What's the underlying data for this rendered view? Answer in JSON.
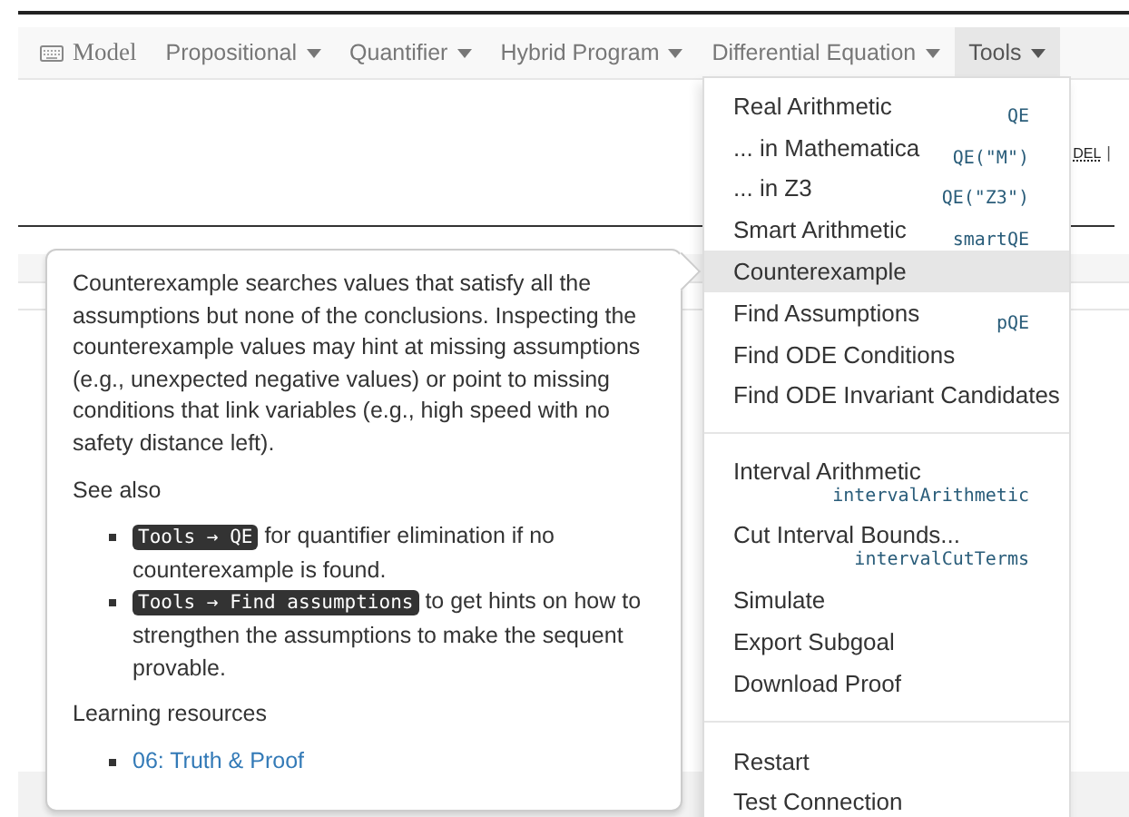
{
  "navbar": {
    "brand": "Model",
    "items": [
      {
        "label": "Propositional",
        "selected": false
      },
      {
        "label": "Quantifier",
        "selected": false
      },
      {
        "label": "Hybrid Program",
        "selected": false
      },
      {
        "label": "Differential Equation",
        "selected": false
      },
      {
        "label": "Tools",
        "selected": true
      }
    ]
  },
  "page": {
    "fragment": "DEL",
    "cursor": "|"
  },
  "menu": {
    "groups": [
      [
        {
          "label": "Real Arithmetic",
          "shortcut": "QE",
          "kind": "inline",
          "selected": false
        },
        {
          "label": "... in Mathematica",
          "shortcut": "QE(\"M\")",
          "kind": "inline",
          "selected": false
        },
        {
          "label": "... in Z3",
          "shortcut": "QE(\"Z3\")",
          "kind": "inline",
          "selected": false
        },
        {
          "label": "Smart Arithmetic",
          "shortcut": "smartQE",
          "kind": "inline",
          "selected": false
        },
        {
          "label": "Counterexample",
          "kind": "inline",
          "selected": true
        },
        {
          "label": "Find Assumptions",
          "shortcut": "pQE",
          "kind": "inline",
          "selected": false
        },
        {
          "label": "Find ODE Conditions",
          "kind": "inline",
          "selected": false
        },
        {
          "label": "Find ODE Invariant Candidates",
          "kind": "inline",
          "selected": false
        }
      ],
      [
        {
          "label": "Interval Arithmetic",
          "shortcut": "intervalArithmetic",
          "kind": "below",
          "selected": false
        },
        {
          "label": "Cut Interval Bounds...",
          "shortcut": "intervalCutTerms",
          "kind": "below",
          "selected": false
        },
        {
          "label": "Simulate",
          "kind": "inline",
          "selected": false
        },
        {
          "label": "Export Subgoal",
          "kind": "inline",
          "selected": false
        },
        {
          "label": "Download Proof",
          "kind": "inline",
          "selected": false
        }
      ],
      [
        {
          "label": "Restart",
          "kind": "inline",
          "selected": false
        },
        {
          "label": "Test Connection",
          "kind": "inline",
          "selected": false
        }
      ]
    ]
  },
  "popover": {
    "paragraph": "Counterexample searches values that satisfy all the assumptions but none of the conclusions. Inspecting the counterexample values may hint at missing assumptions (e.g., unexpected negative values) or point to missing conditions that link variables (e.g., high speed with no safety distance left).",
    "see_also_heading": "See also",
    "see_also": [
      {
        "code": "Tools → QE",
        "text": "for quantifier elimination if no counterexample is found."
      },
      {
        "code": "Tools → Find assumptions",
        "text": "to get hints on how to strengthen the assumptions to make the sequent provable."
      }
    ],
    "resources_heading": "Learning resources",
    "resources": [
      {
        "label": "06: Truth & Proof"
      }
    ]
  }
}
